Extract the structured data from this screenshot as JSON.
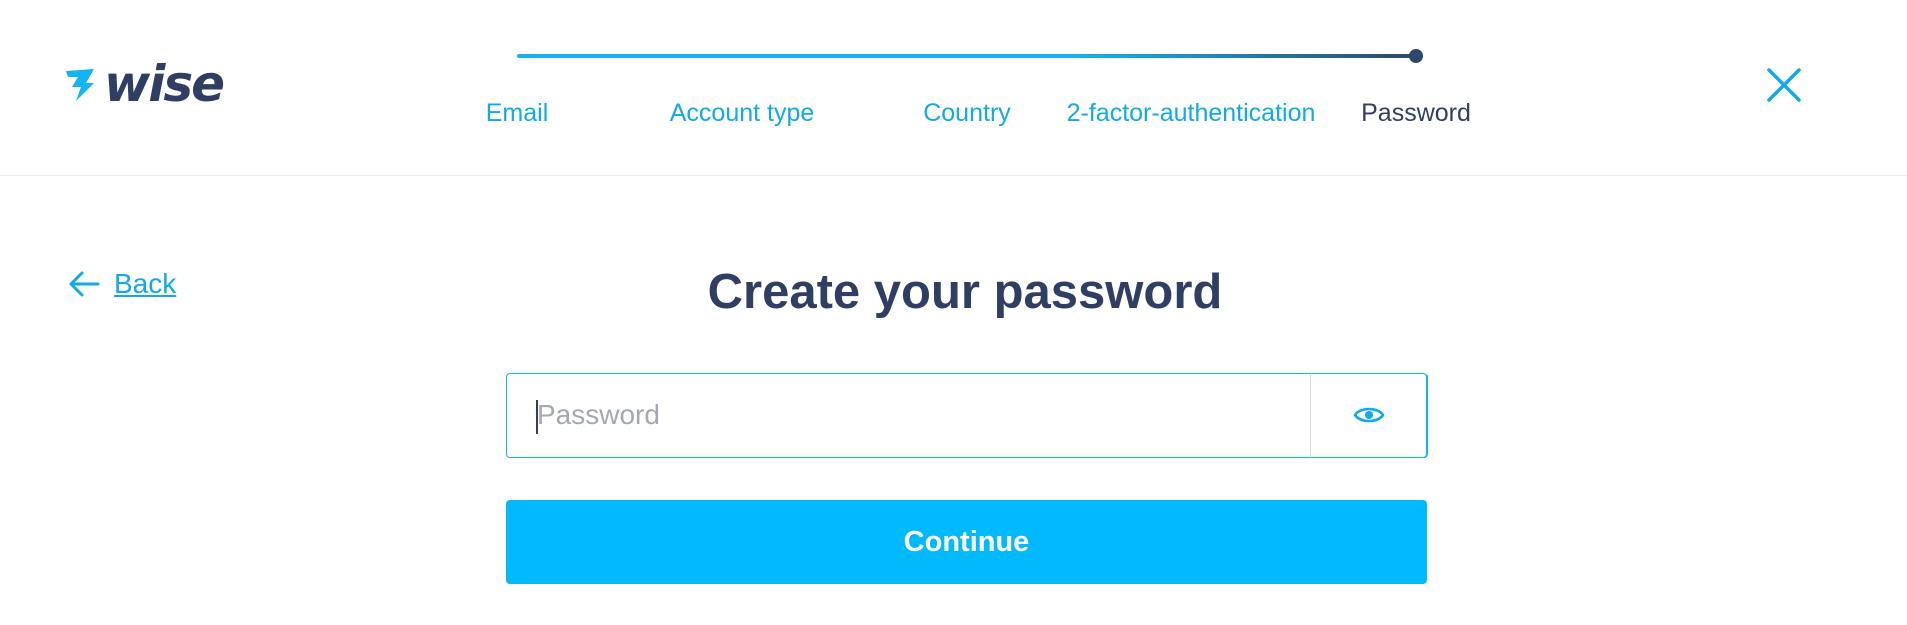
{
  "brand": {
    "name": "wise",
    "color_primary": "#2f3f63",
    "color_accent": "#00b9ff"
  },
  "stepper": {
    "steps": [
      {
        "label": "Email",
        "state": "done"
      },
      {
        "label": "Account type",
        "state": "done"
      },
      {
        "label": "Country",
        "state": "done"
      },
      {
        "label": "2-factor-authentication",
        "state": "done"
      },
      {
        "label": "Password",
        "state": "current"
      }
    ],
    "progress": 1.0
  },
  "header": {
    "close_icon": "close-icon"
  },
  "nav": {
    "back_label": "Back",
    "back_icon": "arrow-left-icon"
  },
  "main": {
    "title": "Create your password",
    "password": {
      "placeholder": "Password",
      "value": "",
      "toggle_icon": "eye-icon"
    },
    "continue_label": "Continue"
  }
}
